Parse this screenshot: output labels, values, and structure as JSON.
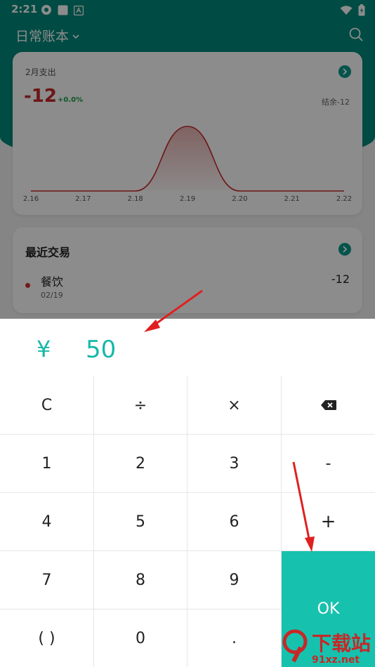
{
  "status_bar": {
    "time": "2:21"
  },
  "header": {
    "title": "日常账本"
  },
  "summary_card": {
    "title": "2月支出",
    "amount": "-12",
    "change": "+0.0%",
    "balance": "结余-12"
  },
  "chart_data": {
    "type": "area",
    "categories": [
      "2.16",
      "2.17",
      "2.18",
      "2.19",
      "2.20",
      "2.21",
      "2.22"
    ],
    "values": [
      0,
      0,
      0,
      12,
      0,
      0,
      0
    ],
    "color": "#c62828"
  },
  "recent_card": {
    "title": "最近交易",
    "transactions": [
      {
        "category": "餐饮",
        "date": "02/19",
        "amount": "-12"
      }
    ]
  },
  "keypad": {
    "currency": "¥",
    "value": "50",
    "keys": {
      "clear": "C",
      "divide": "÷",
      "multiply": "×",
      "k1": "1",
      "k2": "2",
      "k3": "3",
      "minus": "-",
      "k4": "4",
      "k5": "5",
      "k6": "6",
      "plus": "+",
      "k7": "7",
      "k8": "8",
      "k9": "9",
      "paren": "( )",
      "k0": "0",
      "dot": ".",
      "ok": "OK"
    },
    "accent": "#16c2ae"
  },
  "watermark": {
    "brand": "下载站",
    "domain": "91xz.net"
  }
}
